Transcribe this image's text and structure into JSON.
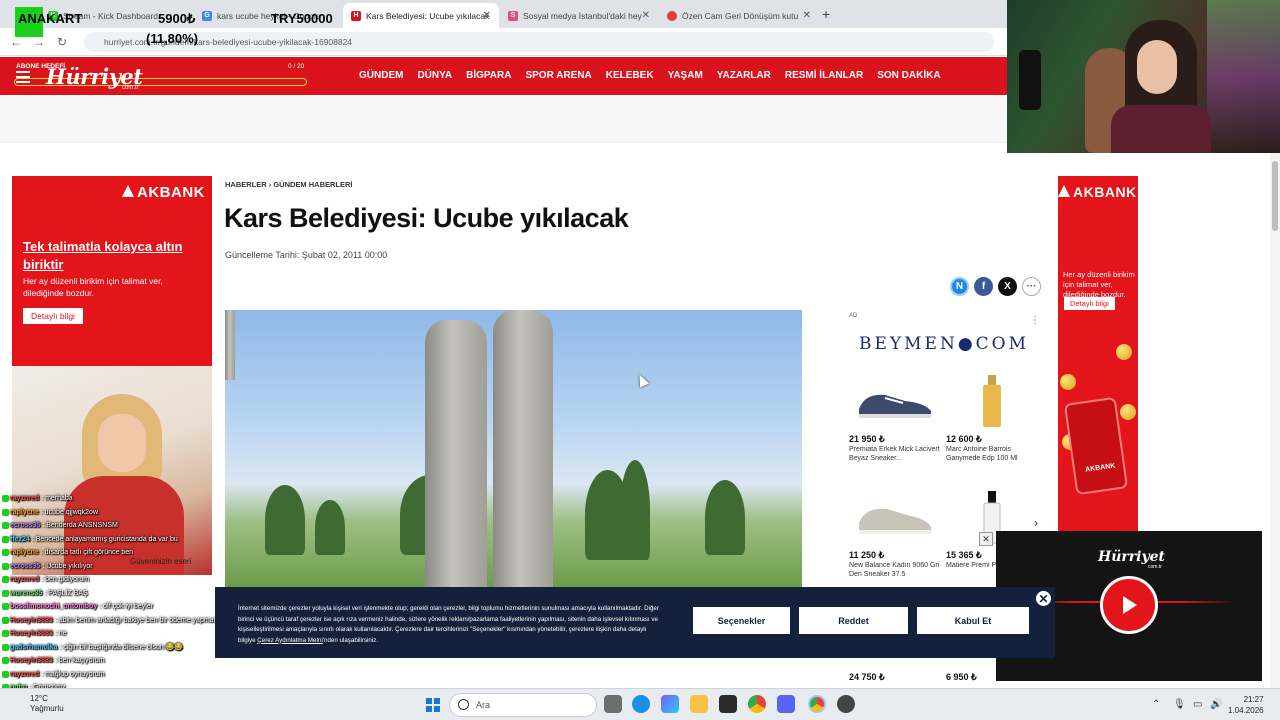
{
  "browser": {
    "tabs": [
      {
        "label": "Stream - Kick Dashboard",
        "active": false
      },
      {
        "label": "kars ucube heykel - Google",
        "active": false
      },
      {
        "label": "Kars Belediyesi: Ucube yıkılacak",
        "active": true
      },
      {
        "label": "Sosyal medya İstanbul'daki hey",
        "active": false
      },
      {
        "label": "Özen Cam Geri Dönüşüm kutu",
        "active": false
      }
    ],
    "url": "hurriyet.com.tr/gundem/kars-belediyesi-ucube-yikilacak-16908824"
  },
  "stream_overlay": {
    "label": "ANAKART",
    "price": "5900₺",
    "percent": "(11,80%)",
    "target": "TRY50000"
  },
  "site": {
    "subscribe_goal": "ABONE HEDEFİ",
    "subscribe_count": "0 / 20",
    "subscribe_fraction": 0.0,
    "logo": "Hürriyet",
    "logo_sub": "com.tr",
    "nav": [
      "GÜNDEM",
      "DÜNYA",
      "BİGPARA",
      "SPOR ARENA",
      "KELEBEK",
      "YAŞAM",
      "YAZARLAR",
      "RESMİ İLANLAR",
      "SON DAKİKA"
    ]
  },
  "article": {
    "breadcrumb": "HABERLER › GÜNDEM HABERLERİ",
    "title": "Kars Belediyesi: Ucube yıkılacak",
    "update_date": "Güncelleme Tarihi: Şubat 02, 2011 00:00"
  },
  "left_ad": {
    "brand": "AKBANK",
    "headline": "Tek talimatla kolayca altın biriktir",
    "sub": "Her ay düzenli birikim için talimat ver, dilediğinde bozdur.",
    "button": "Detaylı bilgi",
    "caption": "Güveninizin eseri"
  },
  "right_ad": {
    "brand": "AKBANK",
    "sub": "Her ay düzenli birikim için talimat ver, dilediğinde bozdur.",
    "button": "Detaylı bilgi",
    "phone_label": "AKBANK"
  },
  "beymen_ad": {
    "ad_label": "AD",
    "logo": "BEYMEN●COM",
    "products": [
      {
        "price": "21 950 ₺",
        "name": "Premiata Erkek Mick Lacivert Beyaz Sneaker..."
      },
      {
        "price": "12 600 ₺",
        "name": "Marc Antoine Barrois Ganymede Edp 100 Ml"
      },
      {
        "price": "11 250 ₺",
        "name": "New Balance Kadın 9060 Gri Deri Sneaker 37.5"
      },
      {
        "price": "15 365 ₺",
        "name": "Matiere Premi Powder 100ml"
      }
    ],
    "bottom_prices": [
      "24 750 ₺",
      "6 950 ₺"
    ]
  },
  "video": {
    "logo": "Hürriyet",
    "logo_sub": "com.tr"
  },
  "chat": [
    {
      "user": "rayznred",
      "msg": ": merhaba",
      "color": "#ff4d4d"
    },
    {
      "user": "raplycne",
      "msg": ": ucube qjjwqk2ow",
      "color": "#ff9f1a"
    },
    {
      "user": "ecross35",
      "msg": ": Benderda ANSNSNSM",
      "color": "#b07fff"
    },
    {
      "user": "ffez24",
      "msg": ": Bencede anlayamamış guricistanda da var bu",
      "color": "#44c7ff"
    },
    {
      "user": "raplycne",
      "msg": ": dısarda tatlı çift görünce ben",
      "color": "#ff9f1a"
    },
    {
      "user": "ecross35",
      "msg": ": Ucube yıkılıyor",
      "color": "#b07fff"
    },
    {
      "user": "rayznred",
      "msg": ": ben gidiyorum",
      "color": "#ff4d4d"
    },
    {
      "user": "wurens35",
      "msg": ": PAŞLİZ BAŞ",
      "color": "#66e066"
    },
    {
      "user": "bosslimonochi_ontomboy",
      "msg": ": off çok iyi beyler",
      "color": "#ff7ad9"
    },
    {
      "user": "Huseyin3883",
      "msg": ": abim benim anladığı bakiye ben bir ödeme yapmadım",
      "color": "#ff4d4d"
    },
    {
      "user": "Huseyin3883",
      "msg": ": ne",
      "color": "#ff4d4d"
    },
    {
      "user": "gadsrhamolka",
      "msg": ": çiğin bil başlığında dilsene olsun 😂😂",
      "color": "#44c7ff"
    },
    {
      "user": "Huseyin3883",
      "msg": ": ben kaçıyorum",
      "color": "#ff4d4d"
    },
    {
      "user": "rayznred",
      "msg": ": mağlup oynuyorum",
      "color": "#ff4d4d"
    },
    {
      "user": "pubg",
      "msg": ": Görüşürüz",
      "color": "#66e066"
    }
  ],
  "cookie": {
    "text": "İnternet sitemizde çerezler yoluyla kişisel veri işlenmekte olup; gerekli olan çerezler, bilgi toplumu hizmetlerinin sunulması amacıyla kullanılmaktadır. Diğer birinci ve üçüncü taraf çerezler ise açık rıza vermeniz halinde, sizlere yönelik reklam/pazarlama faaliyetlerinin yapılması, sitenin daha işlevsel kılınması ve kişiselleştirilmesi amaçlarıyla sınırlı olarak kullanılacaktır. Çerezlere dair tercihlerinizi \"Seçenekler\" kısmından yönetebilir, çerezlere ilişkin daha detaylı bilgiye",
    "link": "Çerez Aydınlatma Metni",
    "text_end": "'nden ulaşabilirsiniz.",
    "options": "Seçenekler",
    "reject": "Reddet",
    "accept": "Kabul Et"
  },
  "taskbar": {
    "weather_temp": "12°C",
    "weather_text": "Yağmurlu",
    "search": "Ara",
    "time": "21:27",
    "date": "1.04.2026"
  },
  "colors": {
    "hurriyet_red": "#d9121b",
    "akbank_red": "#e3141a",
    "cookie_bg": "#14213d"
  }
}
